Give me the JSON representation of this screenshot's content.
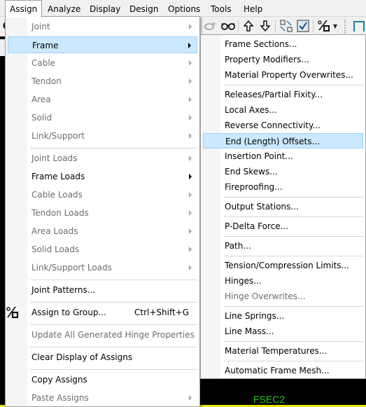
{
  "menubar": {
    "items": [
      "Assign",
      "Analyze",
      "Display",
      "Design",
      "Options",
      "Tools",
      "Help"
    ],
    "active": "Assign"
  },
  "toolbar": {
    "icons": [
      "rotate-3d-icon",
      "glasses-icon",
      "arrow-up-icon",
      "arrow-down-icon",
      "expand-selection-icon",
      "checkbox-icon",
      "assign-to-group-icon",
      "dropdown-caret-icon",
      "frame-icon"
    ]
  },
  "assign_menu": {
    "items": [
      {
        "label": "Joint",
        "disabled": true,
        "submenu": true
      },
      {
        "label": "Frame",
        "disabled": false,
        "submenu": true,
        "highlighted": true
      },
      {
        "label": "Cable",
        "disabled": true,
        "submenu": true
      },
      {
        "label": "Tendon",
        "disabled": true,
        "submenu": true
      },
      {
        "label": "Area",
        "disabled": true,
        "submenu": true
      },
      {
        "label": "Solid",
        "disabled": true,
        "submenu": true
      },
      {
        "label": "Link/Support",
        "disabled": true,
        "submenu": true
      },
      {
        "label": "Joint Loads",
        "disabled": true,
        "submenu": true
      },
      {
        "label": "Frame Loads",
        "disabled": false,
        "submenu": true
      },
      {
        "label": "Cable Loads",
        "disabled": true,
        "submenu": true
      },
      {
        "label": "Tendon Loads",
        "disabled": true,
        "submenu": true
      },
      {
        "label": "Area Loads",
        "disabled": true,
        "submenu": true
      },
      {
        "label": "Solid Loads",
        "disabled": true,
        "submenu": true
      },
      {
        "label": "Link/Support Loads",
        "disabled": true,
        "submenu": true
      },
      {
        "label": "Joint Patterns...",
        "disabled": false
      },
      {
        "label": "Assign to Group...",
        "disabled": false,
        "shortcut": "Ctrl+Shift+G",
        "icon": "assign-to-group-icon"
      },
      {
        "label": "Update All Generated Hinge Properties",
        "disabled": true
      },
      {
        "label": "Clear Display of Assigns",
        "disabled": false
      },
      {
        "label": "Copy Assigns",
        "disabled": false
      },
      {
        "label": "Paste Assigns",
        "disabled": true,
        "submenu": true
      }
    ]
  },
  "frame_submenu": {
    "items": [
      {
        "label": "Frame Sections...",
        "disabled": false
      },
      {
        "label": "Property Modifiers...",
        "disabled": false
      },
      {
        "label": "Material Property Overwrites...",
        "disabled": false
      },
      {
        "label": "Releases/Partial Fixity...",
        "disabled": false
      },
      {
        "label": "Local Axes...",
        "disabled": false
      },
      {
        "label": "Reverse Connectivity...",
        "disabled": false
      },
      {
        "label": "End (Length) Offsets...",
        "disabled": false,
        "highlighted": true
      },
      {
        "label": "Insertion Point...",
        "disabled": false
      },
      {
        "label": "End Skews...",
        "disabled": false
      },
      {
        "label": "Fireproofing...",
        "disabled": false
      },
      {
        "label": "Output Stations...",
        "disabled": false
      },
      {
        "label": "P-Delta Force...",
        "disabled": false
      },
      {
        "label": "Path...",
        "disabled": false
      },
      {
        "label": "Tension/Compression Limits...",
        "disabled": false
      },
      {
        "label": "Hinges...",
        "disabled": false
      },
      {
        "label": "Hinge Overwrites...",
        "disabled": true
      },
      {
        "label": "Line Springs...",
        "disabled": false
      },
      {
        "label": "Line Mass...",
        "disabled": false
      },
      {
        "label": "Material Temperatures...",
        "disabled": false
      },
      {
        "label": "Automatic Frame Mesh...",
        "disabled": false
      }
    ]
  },
  "canvas": {
    "label": "FSEC2",
    "label_color": "#22cc22"
  },
  "colors": {
    "highlight_bg": "#cce8ff",
    "highlight_border": "#99d1ff",
    "disabled_text": "#6d6d6d"
  }
}
